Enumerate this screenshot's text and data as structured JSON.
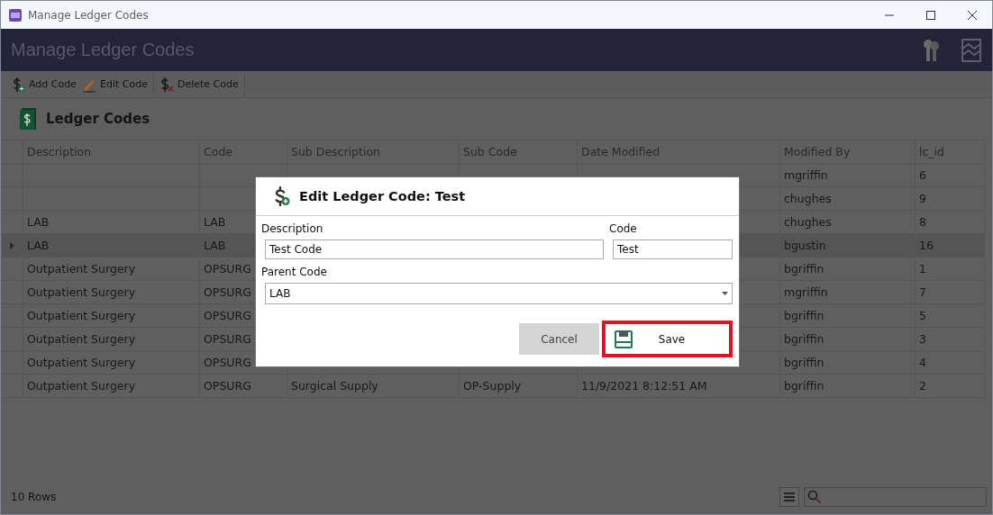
{
  "window": {
    "title": "Manage Ledger Codes"
  },
  "header": {
    "title": "Manage Ledger Codes"
  },
  "toolbar": [
    {
      "label": "Add Code",
      "kind": "add"
    },
    {
      "label": "Edit Code",
      "kind": "edit"
    },
    {
      "label": "Delete Code",
      "kind": "delete"
    }
  ],
  "section": {
    "title": "Ledger Codes"
  },
  "table": {
    "columns": [
      "Description",
      "Code",
      "Sub Description",
      "Sub Code",
      "Date Modified",
      "Modified By",
      "lc_id"
    ],
    "rows": [
      {
        "selected": false,
        "cells": [
          null,
          null,
          null,
          null,
          null,
          "mgriffin",
          "6"
        ]
      },
      {
        "selected": false,
        "cells": [
          null,
          null,
          null,
          null,
          null,
          "chughes",
          "9"
        ]
      },
      {
        "selected": false,
        "cells": [
          "LAB",
          "LAB",
          null,
          null,
          null,
          "chughes",
          "8"
        ]
      },
      {
        "selected": true,
        "cells": [
          "LAB",
          "LAB",
          null,
          null,
          null,
          "bgustin",
          "16"
        ]
      },
      {
        "selected": false,
        "cells": [
          "Outpatient Surgery",
          "OPSURG",
          null,
          null,
          null,
          "bgriffin",
          "1"
        ]
      },
      {
        "selected": false,
        "cells": [
          "Outpatient Surgery",
          "OPSURG",
          null,
          null,
          null,
          "mgriffin",
          "7"
        ]
      },
      {
        "selected": false,
        "cells": [
          "Outpatient Surgery",
          "OPSURG",
          null,
          null,
          null,
          "bgriffin",
          "5"
        ]
      },
      {
        "selected": false,
        "cells": [
          "Outpatient Surgery",
          "OPSURG",
          null,
          null,
          null,
          "bgriffin",
          "3"
        ]
      },
      {
        "selected": false,
        "cells": [
          "Outpatient Surgery",
          "OPSURG",
          null,
          null,
          null,
          "bgriffin",
          "4"
        ]
      },
      {
        "selected": false,
        "cells": [
          "Outpatient Surgery",
          "OPSURG",
          "Surgical Supply",
          "OP-Supply",
          "11/9/2021 8:12:51 AM",
          "bgriffin",
          "2"
        ]
      }
    ]
  },
  "status_bar": {
    "row_count": "10 Rows"
  },
  "dialog": {
    "title": "Edit Ledger Code: Test",
    "description": {
      "label": "Description",
      "value": "Test Code"
    },
    "code": {
      "label": "Code",
      "value": "Test"
    },
    "parent_code": {
      "label": "Parent Code",
      "value": "LAB"
    },
    "buttons": [
      {
        "label": "Cancel",
        "kind": "cancel",
        "highlighted": false
      },
      {
        "label": "Save",
        "kind": "save",
        "highlighted": true
      }
    ]
  }
}
